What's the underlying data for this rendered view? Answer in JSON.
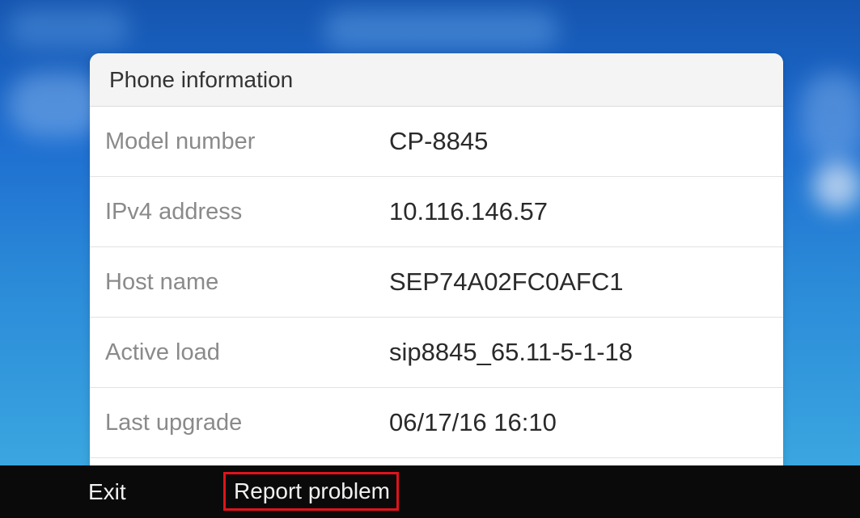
{
  "dialog": {
    "title": "Phone information",
    "rows": [
      {
        "label": "Model number",
        "value": "CP-8845"
      },
      {
        "label": "IPv4 address",
        "value": "10.116.146.57"
      },
      {
        "label": "Host name",
        "value": "SEP74A02FC0AFC1"
      },
      {
        "label": "Active load",
        "value": "sip8845_65.11-5-1-18"
      },
      {
        "label": "Last upgrade",
        "value": "06/17/16 16:10"
      }
    ]
  },
  "softkeys": {
    "exit_label": "Exit",
    "report_label": "Report problem"
  },
  "colors": {
    "highlight_border": "#e0131a",
    "softkey_bar": "#0a0a0a",
    "wallpaper": "#1e6ed0"
  }
}
